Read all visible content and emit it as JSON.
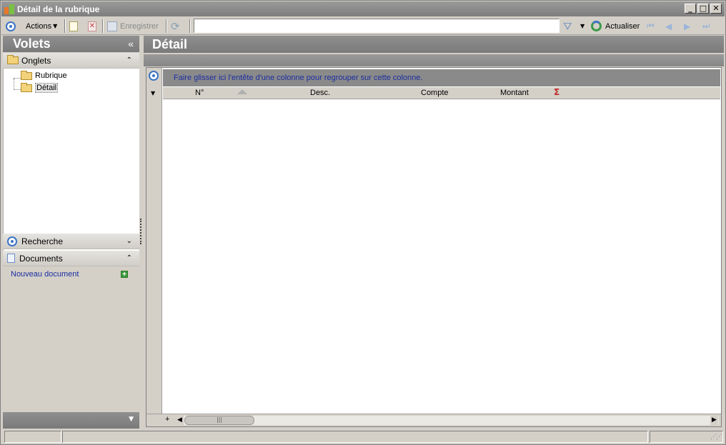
{
  "window": {
    "title": "Détail de la rubrique",
    "controls": [
      "_",
      "□",
      "✕"
    ]
  },
  "toolbar": {
    "actions_label": "Actions",
    "save_label": "Enregistrer",
    "search_value": "",
    "refresh_label": "Actualiser"
  },
  "left_pane": {
    "title": "Volets",
    "collapse_glyph": "«",
    "tabs_section": {
      "label": "Onglets",
      "items": [
        {
          "label": "Rubrique",
          "selected": false
        },
        {
          "label": "Détail",
          "selected": true
        }
      ]
    },
    "search_section": {
      "label": "Recherche"
    },
    "documents_section": {
      "label": "Documents",
      "new_document_link": "Nouveau document"
    }
  },
  "detail": {
    "title": "Détail",
    "group_hint": "Faire glisser ici l'entête d'une colonne pour regrouper sur cette colonne.",
    "columns": [
      "N°",
      "Desc.",
      "Compte",
      "Montant"
    ],
    "sum_symbol": "Σ",
    "add_row_glyph": "+"
  },
  "colors": {
    "header_gradient": "#7a7a7a",
    "link": "#1b2ea0",
    "accent_icon": "#3b73c4",
    "sum": "#c0282a"
  }
}
